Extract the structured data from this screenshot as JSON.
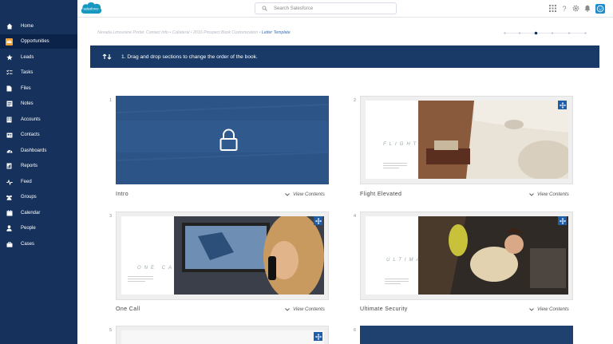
{
  "header": {
    "logo_text": "salesforce",
    "search_placeholder": "Search Salesforce"
  },
  "sidebar": {
    "items": [
      {
        "label": "Home",
        "icon": "home-icon",
        "active": false
      },
      {
        "label": "Opportunities",
        "icon": "crown-icon",
        "active": true
      },
      {
        "label": "Leads",
        "icon": "star-icon",
        "active": false
      },
      {
        "label": "Tasks",
        "icon": "checklist-icon",
        "active": false
      },
      {
        "label": "Files",
        "icon": "file-icon",
        "active": false
      },
      {
        "label": "Notes",
        "icon": "note-icon",
        "active": false
      },
      {
        "label": "Accounts",
        "icon": "building-icon",
        "active": false
      },
      {
        "label": "Contacts",
        "icon": "contact-card-icon",
        "active": false
      },
      {
        "label": "Dashboards",
        "icon": "dashboard-icon",
        "active": false
      },
      {
        "label": "Reports",
        "icon": "report-icon",
        "active": false
      },
      {
        "label": "Feed",
        "icon": "pulse-icon",
        "active": false
      },
      {
        "label": "Groups",
        "icon": "groups-icon",
        "active": false
      },
      {
        "label": "Calendar",
        "icon": "calendar-icon",
        "active": false
      },
      {
        "label": "People",
        "icon": "person-icon",
        "active": false
      },
      {
        "label": "Cases",
        "icon": "briefcase-icon",
        "active": false
      }
    ]
  },
  "breadcrumb": {
    "path": "Nevada Limousine Portal: Contact Info • Collateral • 2016 Prospect Book Customization • ",
    "current": "Letter Template"
  },
  "step": {
    "text": "1. Drag and drop sections to change the order of the book."
  },
  "sections": [
    {
      "number": "1",
      "title": "Intro",
      "view_label": "View Contents",
      "locked": true
    },
    {
      "number": "2",
      "title": "Flight Elevated",
      "view_label": "View Contents",
      "page_heading": "FLIGHT ELEVATED"
    },
    {
      "number": "3",
      "title": "One Call",
      "view_label": "View Contents",
      "page_heading": "ONE CALL"
    },
    {
      "number": "4",
      "title": "Ultimate Security",
      "view_label": "View Contents",
      "page_heading": "ULTIMATE SECURITY"
    },
    {
      "number": "5"
    },
    {
      "number": "6"
    }
  ],
  "colors": {
    "sidebar": "#16325c",
    "banner": "#193a66",
    "accent": "#1c5ea9",
    "active_icon": "#f4a33a"
  }
}
